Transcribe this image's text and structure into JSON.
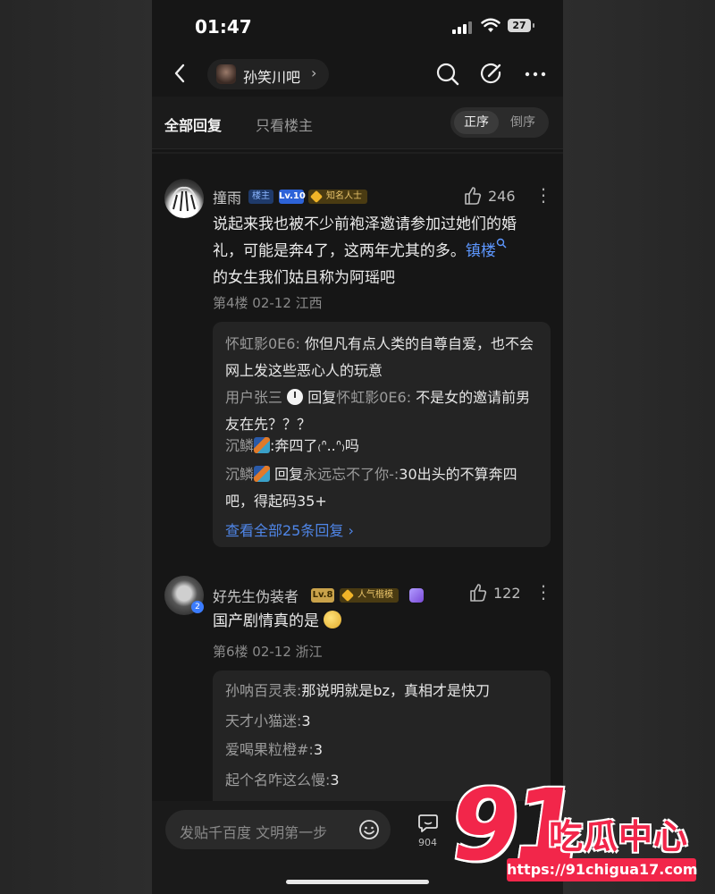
{
  "status_bar": {
    "time": "01:47",
    "battery": "27"
  },
  "nav": {
    "forum_name": "孙笑川吧",
    "forum_arrow": "›"
  },
  "tabs": {
    "all_replies": "全部回复",
    "op_only": "只看楼主",
    "order_asc": "正序",
    "order_desc": "倒序"
  },
  "posts": [
    {
      "username": "撞雨",
      "op_badge": "楼主",
      "level": "Lv.10",
      "honor": "知名人士",
      "likes": "246",
      "more": "⋮",
      "text_main": "说起来我也被不少前袍泽邀请参加过她们的婚礼，可能是奔4了，这两年尤其的多。",
      "text_link": "镇楼",
      "text_after": "的女生我们姑且称为阿瑶吧",
      "meta": "第4楼  02-12  江西",
      "replies": [
        {
          "user": "怀虹影0E6:",
          "text": " 你但凡有点人类的自尊自爱，也不会网上发这些恶心人的玩意"
        },
        {
          "user": "用户张三",
          "connector": "回复",
          "target": "怀虹影0E6:",
          "text": " 不是女的邀请前男友在先？？？"
        },
        {
          "user": "沉鳞",
          "text": ":奔四了₍ᐢ..ᐢ₎吗"
        },
        {
          "user": "沉鳞",
          "connector": "回复",
          "target": "永远忘不了你-:",
          "text": "30出头的不算奔四吧，得起码35+"
        }
      ],
      "view_all": "查看全部25条回复 ›"
    },
    {
      "username": "好先生伪装者",
      "level": "Lv.8",
      "honor": "人气楷模",
      "likes": "122",
      "more": "⋮",
      "text_main": "国产剧情真的是",
      "meta": "第6楼  02-12  浙江",
      "replies": [
        {
          "user": "孙呐百灵表:",
          "text": "那说明就是bz，真相才是快刀"
        },
        {
          "user": "天才小猫迷:",
          "text": "3"
        },
        {
          "user": "爱喝果粒橙#:",
          "text": "3"
        },
        {
          "user": "起个名咋这么慢:",
          "text": "3"
        }
      ]
    }
  ],
  "bottom_bar": {
    "placeholder": "发贴千百度 文明第一步",
    "reply_count": "904"
  },
  "watermark": {
    "number": "91",
    "title": "吃瓜中心",
    "url": "https://91chigua17.com"
  },
  "colors": {
    "background": "#161616",
    "link": "#4f86e8",
    "accent": "#f2264a"
  }
}
